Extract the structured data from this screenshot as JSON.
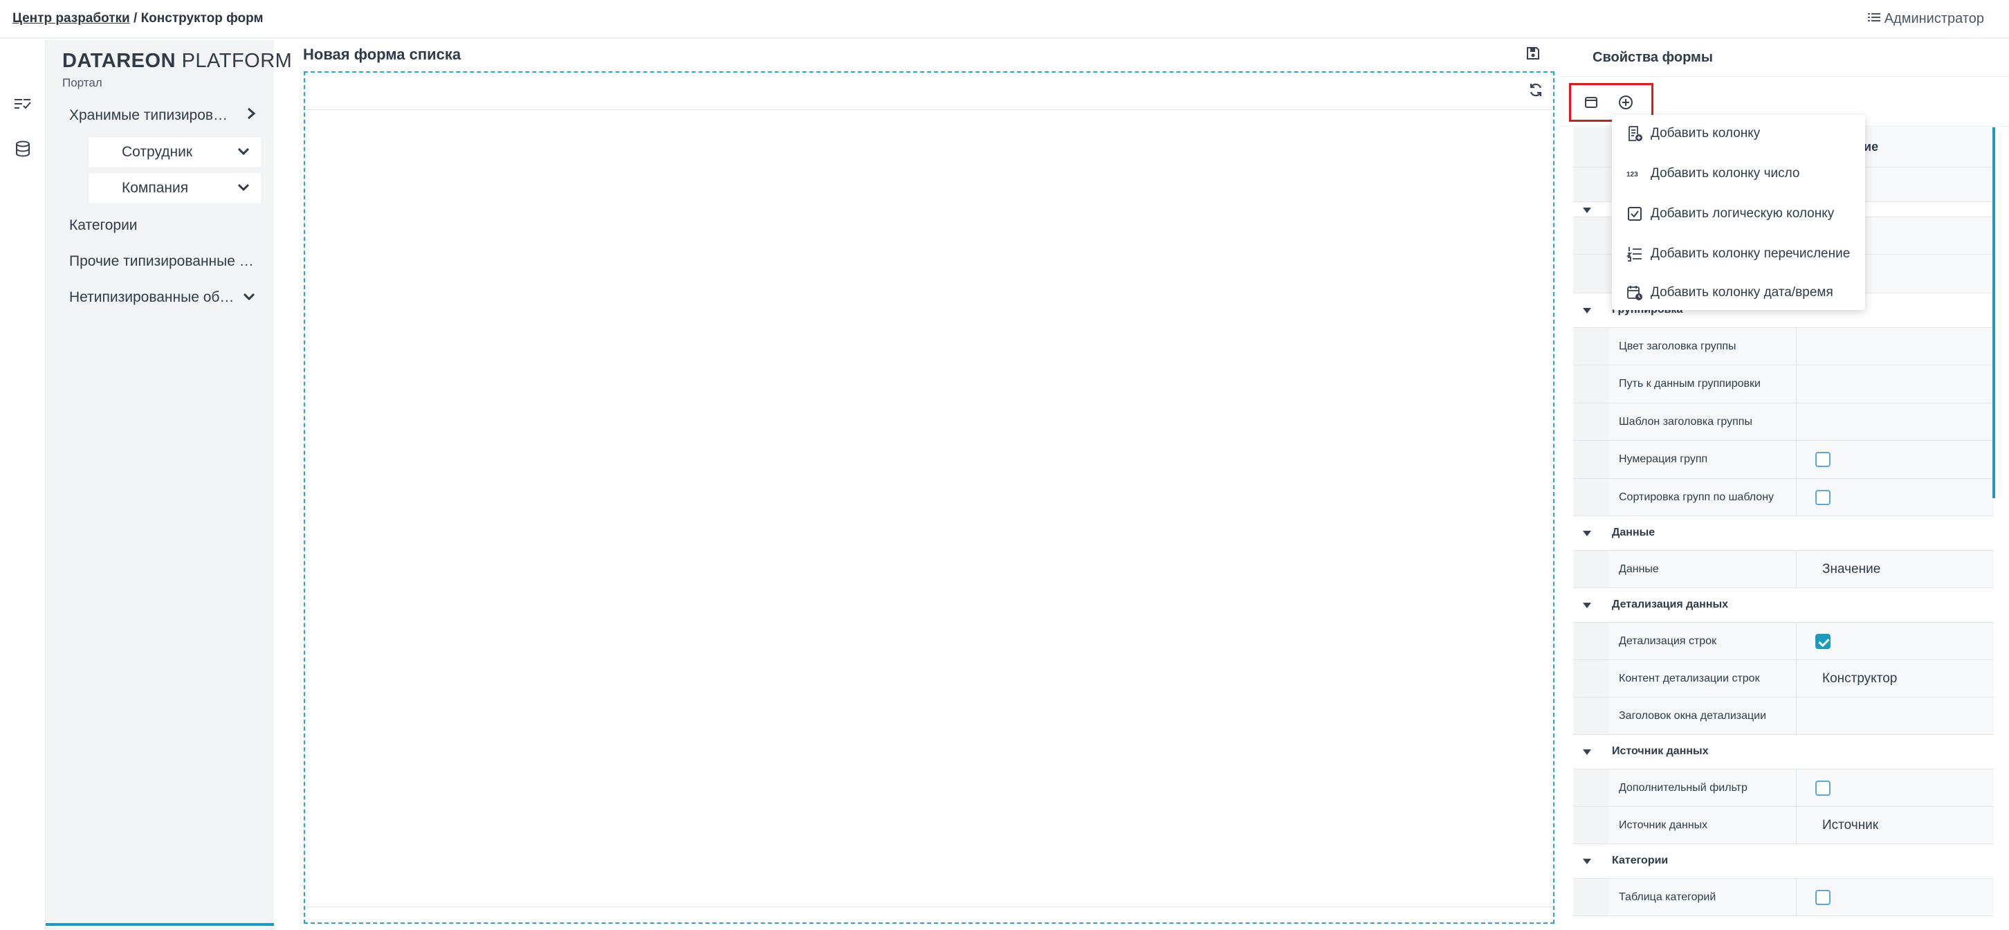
{
  "breadcrumb": {
    "link": "Центр разработки",
    "separator": " / ",
    "current": "Конструктор форм"
  },
  "user": {
    "name": "Администратор",
    "icon": "list-icon"
  },
  "brand": {
    "bold": "DATAREON",
    "light": " PLATFORM",
    "subtitle": "Портал"
  },
  "nav": {
    "items": [
      {
        "label": "Хранимые типизиров…",
        "icon": "chevron-right-icon"
      },
      {
        "label": "Сотрудник",
        "icon": "chevron-down-icon"
      },
      {
        "label": "Компания",
        "icon": "chevron-down-icon"
      },
      {
        "label": "Категории"
      },
      {
        "label": "Прочие типизированные …"
      },
      {
        "label": "Нетипизированные об…",
        "icon": "chevron-down-icon"
      }
    ]
  },
  "canvas": {
    "title": "Новая форма списка"
  },
  "props": {
    "title": "Свойства формы",
    "header_partial": "ие",
    "rows": [
      {
        "type": "category",
        "label": "Группировка"
      },
      {
        "type": "prop",
        "label": "Цвет заголовка группы",
        "value": ""
      },
      {
        "type": "prop",
        "label": "Путь к данным группировки",
        "value": ""
      },
      {
        "type": "prop",
        "label": "Шаблон заголовка группы",
        "value": ""
      },
      {
        "type": "prop",
        "label": "Нумерация групп",
        "checkbox": false
      },
      {
        "type": "prop",
        "label": "Сортировка групп по шаблону",
        "checkbox": false
      },
      {
        "type": "category",
        "label": "Данные"
      },
      {
        "type": "prop",
        "label": "Данные",
        "value": "Значение"
      },
      {
        "type": "category",
        "label": "Детализация данных"
      },
      {
        "type": "prop",
        "label": "Детализация строк",
        "checkbox": true
      },
      {
        "type": "prop",
        "label": "Контент детализации строк",
        "value": "Конструктор"
      },
      {
        "type": "prop",
        "label": "Заголовок окна детализации",
        "value": ""
      },
      {
        "type": "category",
        "label": "Источник данных"
      },
      {
        "type": "prop",
        "label": "Дополнительный фильтр",
        "checkbox": false
      },
      {
        "type": "prop",
        "label": "Источник данных",
        "value": "Источник"
      },
      {
        "type": "category",
        "label": "Категории"
      },
      {
        "type": "prop",
        "label": "Таблица категорий",
        "checkbox": false
      }
    ]
  },
  "menu": {
    "items": [
      {
        "label": "Добавить колонку",
        "icon": "add-column-icon"
      },
      {
        "label": "Добавить колонку число",
        "icon": "number-123-icon"
      },
      {
        "label": "Добавить логическую колонку",
        "icon": "checkbox-icon"
      },
      {
        "label": "Добавить колонку перечисление",
        "icon": "numbered-list-icon"
      },
      {
        "label": "Добавить колонку дата/время",
        "icon": "calendar-clock-icon"
      }
    ]
  },
  "colors": {
    "accent": "#1c9bbf",
    "highlight": "#e0171b",
    "sidebar_bg": "#f3f4f6"
  }
}
